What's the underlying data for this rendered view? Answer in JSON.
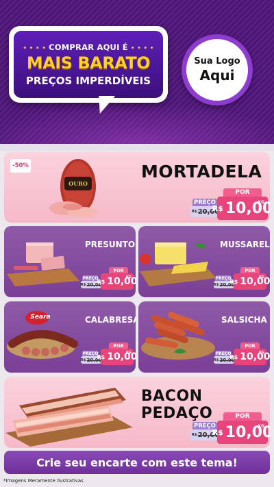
{
  "header": {
    "top_line": "COMPRAR AQUI É",
    "main_line": "MAIS BARATO",
    "sub_line": "PREÇOS IMPERDÍVEIS",
    "dots": "• • • •"
  },
  "logo": {
    "line1": "Sua Logo",
    "line2": "Aqui"
  },
  "products": {
    "mortadela": {
      "name": "MORTADELA",
      "badge": "-50%",
      "preco_label": "PREÇO",
      "por_label": "POR",
      "old_prefix": "R$",
      "old_price": "20,00",
      "new_prefix": "R$",
      "new_price": "10,00",
      "unit": "KG"
    },
    "presunto": {
      "name": "PRESUNTO",
      "preco_label": "PREÇO",
      "por_label": "POR",
      "old_prefix": "R$",
      "old_price": "20,00",
      "new_prefix": "R$",
      "new_price": "10,00",
      "unit": "KG"
    },
    "mussarela": {
      "name": "MUSSARELA",
      "preco_label": "PREÇO",
      "por_label": "POR",
      "old_prefix": "R$",
      "old_price": "20,00",
      "new_prefix": "R$",
      "new_price": "10,00",
      "unit": "KG"
    },
    "calabresa": {
      "name": "CALABRESA",
      "brand": "Seara",
      "preco_label": "PREÇO",
      "por_label": "POR",
      "old_prefix": "R$",
      "old_price": "20,00",
      "new_prefix": "R$",
      "new_price": "10,00",
      "unit": "KG"
    },
    "salsicha": {
      "name": "SALSICHA",
      "preco_label": "PREÇO",
      "por_label": "POR",
      "old_prefix": "R$",
      "old_price": "20,00",
      "new_prefix": "R$",
      "new_price": "10,00",
      "unit": "KG"
    },
    "bacon": {
      "name": "BACON PEDAÇO",
      "preco_label": "PREÇO",
      "por_label": "POR",
      "old_prefix": "R$",
      "old_price": "20,00",
      "new_prefix": "R$",
      "new_price": "10,00",
      "unit": "KG"
    }
  },
  "footer": {
    "cta": "Crie seu encarte com este tema!",
    "disclaimer": "*Imagens Meramente Ilustrativas"
  },
  "colors": {
    "purple": "#5a1f86",
    "yellow": "#ffd21f",
    "pink_price": "#e8447c",
    "card_pink": "#f6b9c9",
    "card_purple": "#7a3f96"
  }
}
